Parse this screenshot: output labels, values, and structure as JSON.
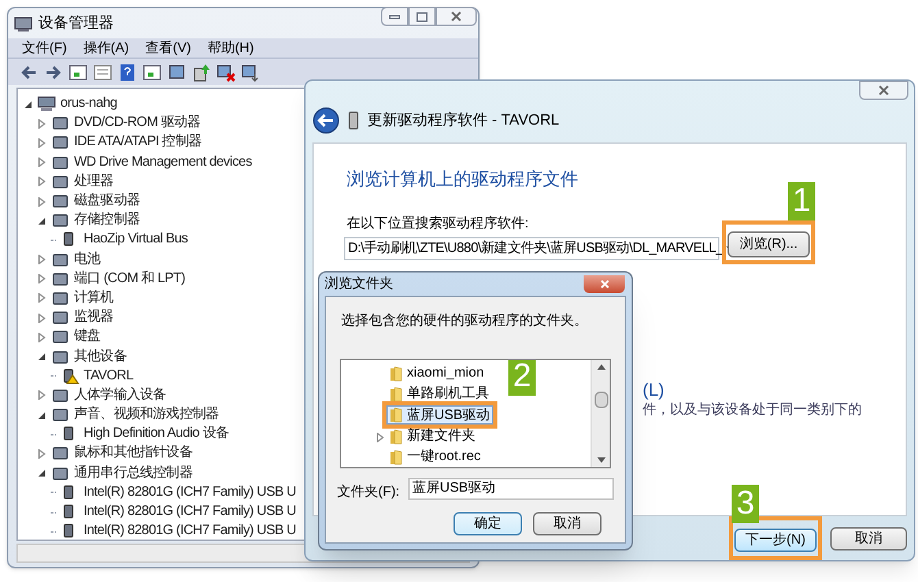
{
  "device_manager": {
    "title": "设备管理器",
    "menu": [
      "文件(F)",
      "操作(A)",
      "查看(V)",
      "帮助(H)"
    ],
    "tree": [
      {
        "label": "orus-nahg",
        "expanded": true,
        "children": [
          {
            "label": "DVD/CD-ROM 驱动器",
            "expanded": false
          },
          {
            "label": "IDE ATA/ATAPI 控制器",
            "expanded": false
          },
          {
            "label": "WD Drive Management devices",
            "expanded": false
          },
          {
            "label": "处理器",
            "expanded": false
          },
          {
            "label": "磁盘驱动器",
            "expanded": false
          },
          {
            "label": "存储控制器",
            "expanded": true,
            "children": [
              {
                "label": "HaoZip Virtual Bus",
                "warning": false
              }
            ]
          },
          {
            "label": "电池",
            "expanded": false
          },
          {
            "label": "端口 (COM 和 LPT)",
            "expanded": false
          },
          {
            "label": "计算机",
            "expanded": false
          },
          {
            "label": "监视器",
            "expanded": false
          },
          {
            "label": "键盘",
            "expanded": false
          },
          {
            "label": "其他设备",
            "expanded": true,
            "children": [
              {
                "label": "TAVORL",
                "warning": true
              }
            ]
          },
          {
            "label": "人体学输入设备",
            "expanded": false
          },
          {
            "label": "声音、视频和游戏控制器",
            "expanded": true,
            "children": [
              {
                "label": "High Definition Audio 设备",
                "warning": false
              }
            ]
          },
          {
            "label": "鼠标和其他指针设备",
            "expanded": false
          },
          {
            "label": "通用串行总线控制器",
            "expanded": true,
            "children": [
              {
                "label": "Intel(R) 82801G (ICH7 Family) USB U",
                "warning": false
              },
              {
                "label": "Intel(R) 82801G (ICH7 Family) USB U",
                "warning": false
              },
              {
                "label": "Intel(R) 82801G (ICH7 Family) USB U",
                "warning": false
              }
            ]
          }
        ]
      }
    ]
  },
  "wizard": {
    "title": "更新驱动程序软件 - TAVORL",
    "heading": "浏览计算机上的驱动程序文件",
    "search_label": "在以下位置搜索驱动程序软件:",
    "path": "D:\\手动刷机\\ZTE\\U880\\新建文件夹\\蓝屏USB驱动\\DL_MARVELL_",
    "browse_button": {
      "label": "浏览(R)...",
      "marker": "1"
    },
    "partial_option": "(L)",
    "partial_text": "件，以及与该设备处于同一类别下的",
    "next_button": {
      "label": "下一步(N)",
      "marker": "3"
    },
    "cancel_button": {
      "label": "取消"
    }
  },
  "browse_dialog": {
    "title": "浏览文件夹",
    "instruction": "选择包含您的硬件的驱动程序的文件夹。",
    "folders": [
      {
        "label": "xiaomi_mion",
        "selected": false,
        "expandable": false
      },
      {
        "label": "单路刷机工具",
        "selected": false,
        "expandable": false
      },
      {
        "label": "蓝屏USB驱动",
        "selected": true,
        "expandable": false,
        "marker": "2"
      },
      {
        "label": "新建文件夹",
        "selected": false,
        "expandable": true
      },
      {
        "label": "一键root.rec",
        "selected": false,
        "expandable": false
      }
    ],
    "folder_label": "文件夹(F):",
    "folder_value": "蓝屏USB驱动",
    "ok_button": "确定",
    "cancel_button": "取消"
  }
}
